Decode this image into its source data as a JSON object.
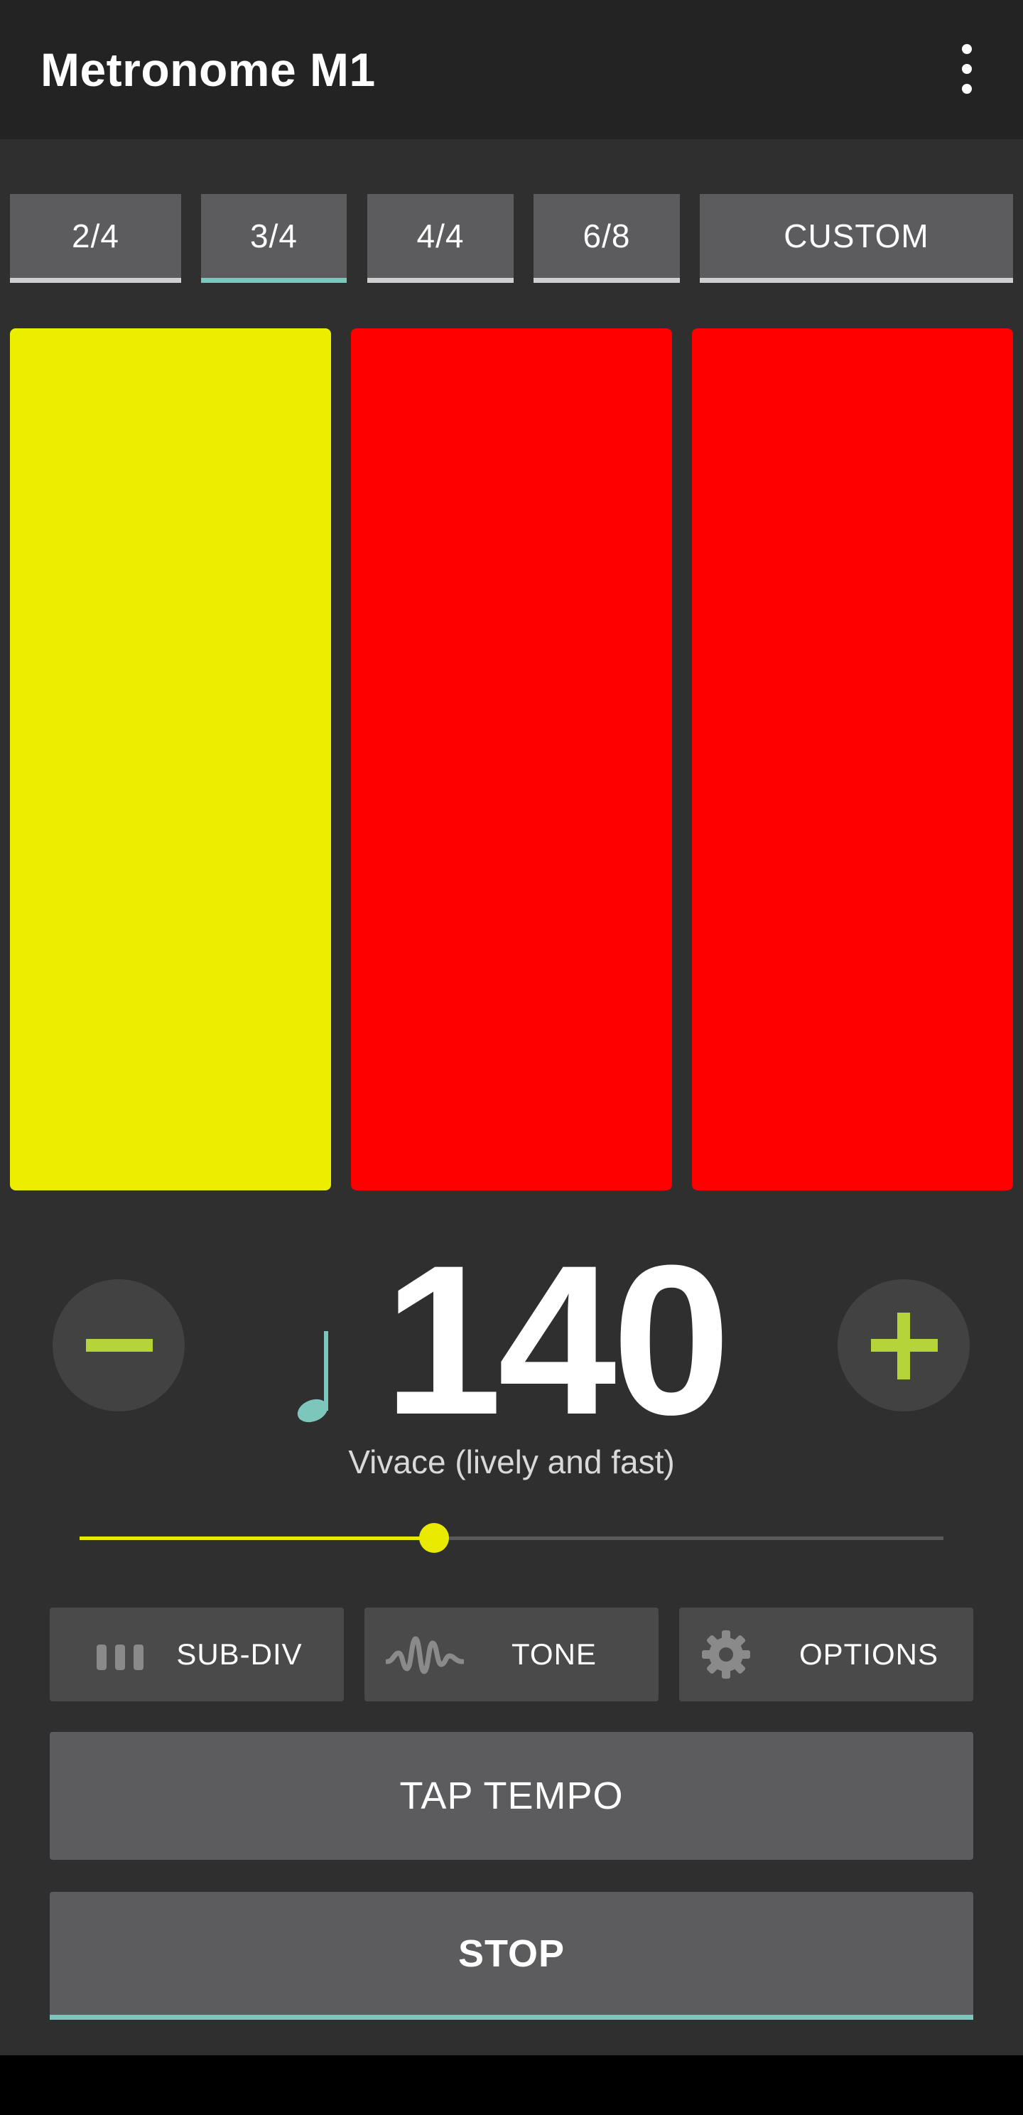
{
  "app": {
    "title": "Metronome M1"
  },
  "time_signatures": [
    {
      "label": "2/4",
      "active": false
    },
    {
      "label": "3/4",
      "active": true
    },
    {
      "label": "4/4",
      "active": false
    },
    {
      "label": "6/8",
      "active": false
    },
    {
      "label": "CUSTOM",
      "active": false
    }
  ],
  "beats": [
    {
      "color": "#eded00",
      "state": "accent-current"
    },
    {
      "color": "#ff0000",
      "state": "normal"
    },
    {
      "color": "#ff0000",
      "state": "normal"
    }
  ],
  "tempo": {
    "bpm": "140",
    "name": "Vivace (lively and fast)",
    "slider_fraction": 0.41
  },
  "tools": {
    "subdiv_label": "SUB-DIV",
    "tone_label": "TONE",
    "options_label": "OPTIONS"
  },
  "actions": {
    "tap_tempo_label": "TAP TEMPO",
    "stop_label": "STOP"
  },
  "colors": {
    "accent_teal": "#7cc6bb",
    "plus_minus_green": "#b4d43a",
    "slider_yellow": "#eaea00"
  }
}
